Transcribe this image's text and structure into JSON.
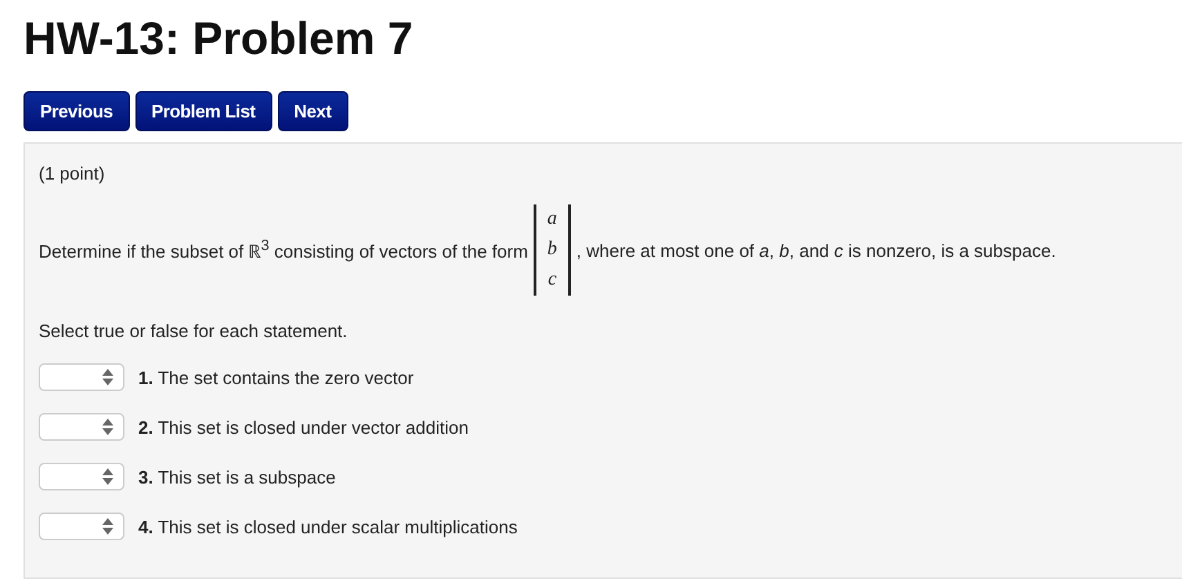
{
  "title": "HW-13: Problem 7",
  "nav_buttons": [
    "Previous",
    "Problem List",
    "Next"
  ],
  "problem": {
    "points": "(1 point)",
    "text_before": "Determine if the subset of ℝ$^{3}$ consisting of vectors of the form",
    "vector": [
      "a",
      "b",
      "c"
    ],
    "text_after": ", where at most one of *a*, *b*, and *c* is nonzero, is a subspace.",
    "instruction": "Select true or false for each statement.",
    "statements": [
      {
        "text": "**1.** The set contains the zero vector"
      },
      {
        "text": "**2.** This set is closed under vector addition"
      },
      {
        "text": "**3.** This set is a subspace"
      },
      {
        "text": "**4.** This set is closed under scalar multiplications"
      }
    ]
  }
}
